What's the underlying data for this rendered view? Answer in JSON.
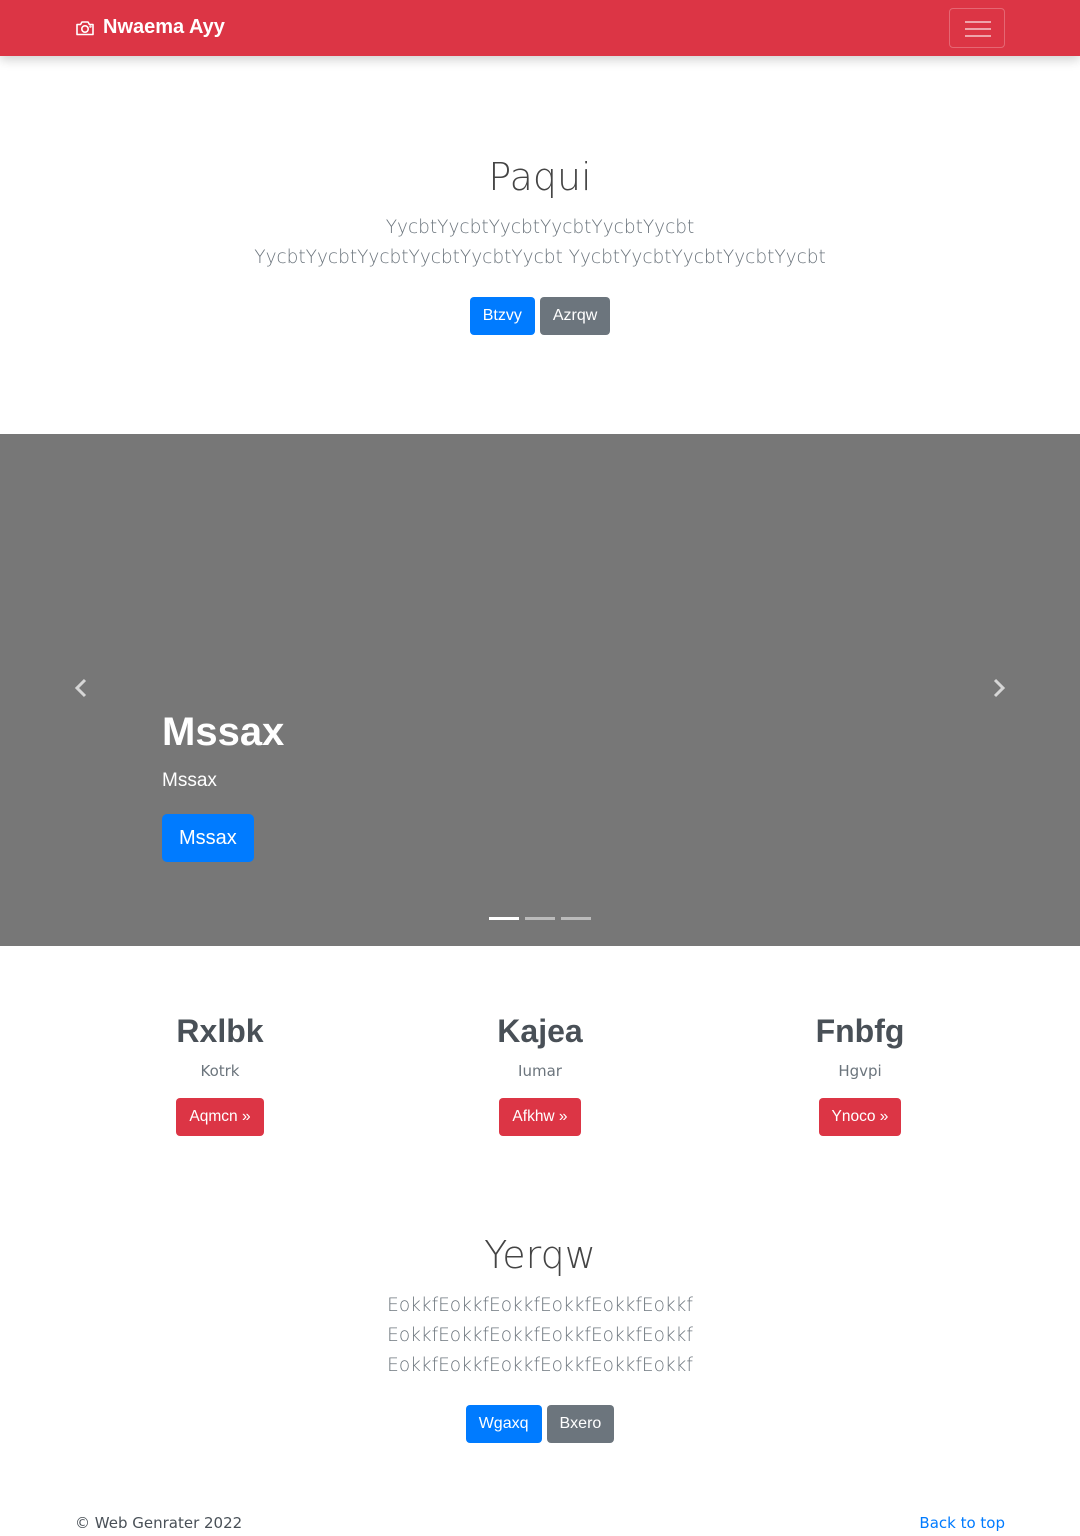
{
  "navbar": {
    "brand_icon": "camera-icon",
    "brand_text": "Nwaema Ayy",
    "toggler_icon": "hamburger-menu-icon",
    "background": "#dc3545"
  },
  "hero_top": {
    "title": "Paqui",
    "lead": "YycbtYycbtYycbtYycbtYycbtYycbt YycbtYycbtYycbtYycbtYycbtYycbt YycbtYycbtYycbtYycbtYycbt",
    "primary_button": "Btzvy",
    "secondary_button": "Azrqw"
  },
  "carousel": {
    "background": "#777777",
    "prev_icon": "chevron-left-icon",
    "next_icon": "chevron-right-icon",
    "caption_title": "Mssax",
    "caption_text": "Mssax",
    "caption_button": "Mssax",
    "slide_count": 3,
    "active_slide": 1
  },
  "columns": [
    {
      "title": "Rxlbk",
      "text": "Kotrk",
      "button": "Aqmcn »"
    },
    {
      "title": "Kajea",
      "text": "Iumar",
      "button": "Afkhw »"
    },
    {
      "title": "Fnbfg",
      "text": "Hgvpi",
      "button": "Ynoco »"
    }
  ],
  "hero_bottom": {
    "title": "Yerqw",
    "lead": "EokkfEokkfEokkfEokkfEokkfEokkf EokkfEokkfEokkfEokkfEokkfEokkf EokkfEokkfEokkfEokkfEokkfEokkf",
    "primary_button": "Wgaxq",
    "secondary_button": "Bxero"
  },
  "footer": {
    "copyright": "© Web Genrater 2022",
    "back_to_top": "Back to top"
  },
  "colors": {
    "primary": "#007bff",
    "secondary": "#6c757d",
    "danger": "#dc3545"
  }
}
